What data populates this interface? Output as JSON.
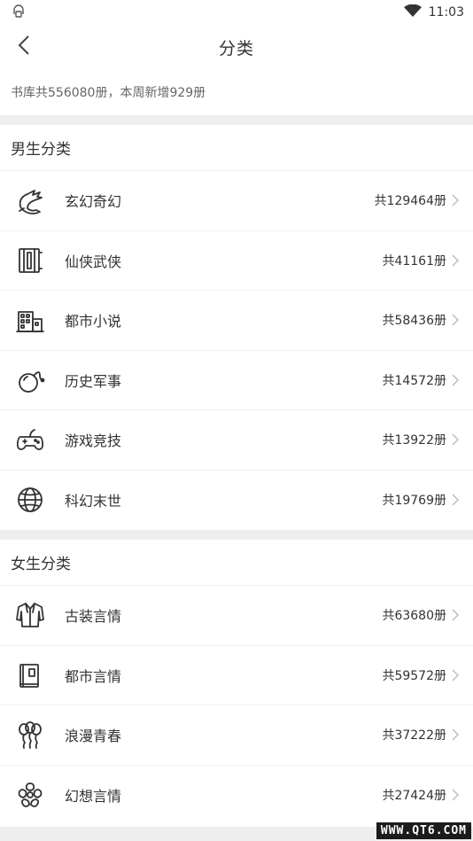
{
  "status_bar": {
    "time": "11:03"
  },
  "nav": {
    "title": "分类"
  },
  "summary": "书库共556080册，本周新增929册",
  "male": {
    "title": "男生分类",
    "items": [
      {
        "icon": "dragon-icon",
        "name": "玄幻奇幻",
        "count": "共129464册"
      },
      {
        "icon": "scroll-book-icon",
        "name": "仙侠武侠",
        "count": "共41161册"
      },
      {
        "icon": "city-buildings-icon",
        "name": "都市小说",
        "count": "共58436册"
      },
      {
        "icon": "bomb-icon",
        "name": "历史军事",
        "count": "共14572册"
      },
      {
        "icon": "gamepad-icon",
        "name": "游戏竞技",
        "count": "共13922册"
      },
      {
        "icon": "globe-icon",
        "name": "科幻末世",
        "count": "共19769册"
      }
    ]
  },
  "female": {
    "title": "女生分类",
    "items": [
      {
        "icon": "robe-icon",
        "name": "古装言情",
        "count": "共63680册"
      },
      {
        "icon": "book-icon",
        "name": "都市言情",
        "count": "共59572册"
      },
      {
        "icon": "balloons-icon",
        "name": "浪漫青春",
        "count": "共37222册"
      },
      {
        "icon": "flower-icon",
        "name": "幻想言情",
        "count": "共27424册"
      }
    ]
  },
  "watermark": "WWW.QT6.COM"
}
